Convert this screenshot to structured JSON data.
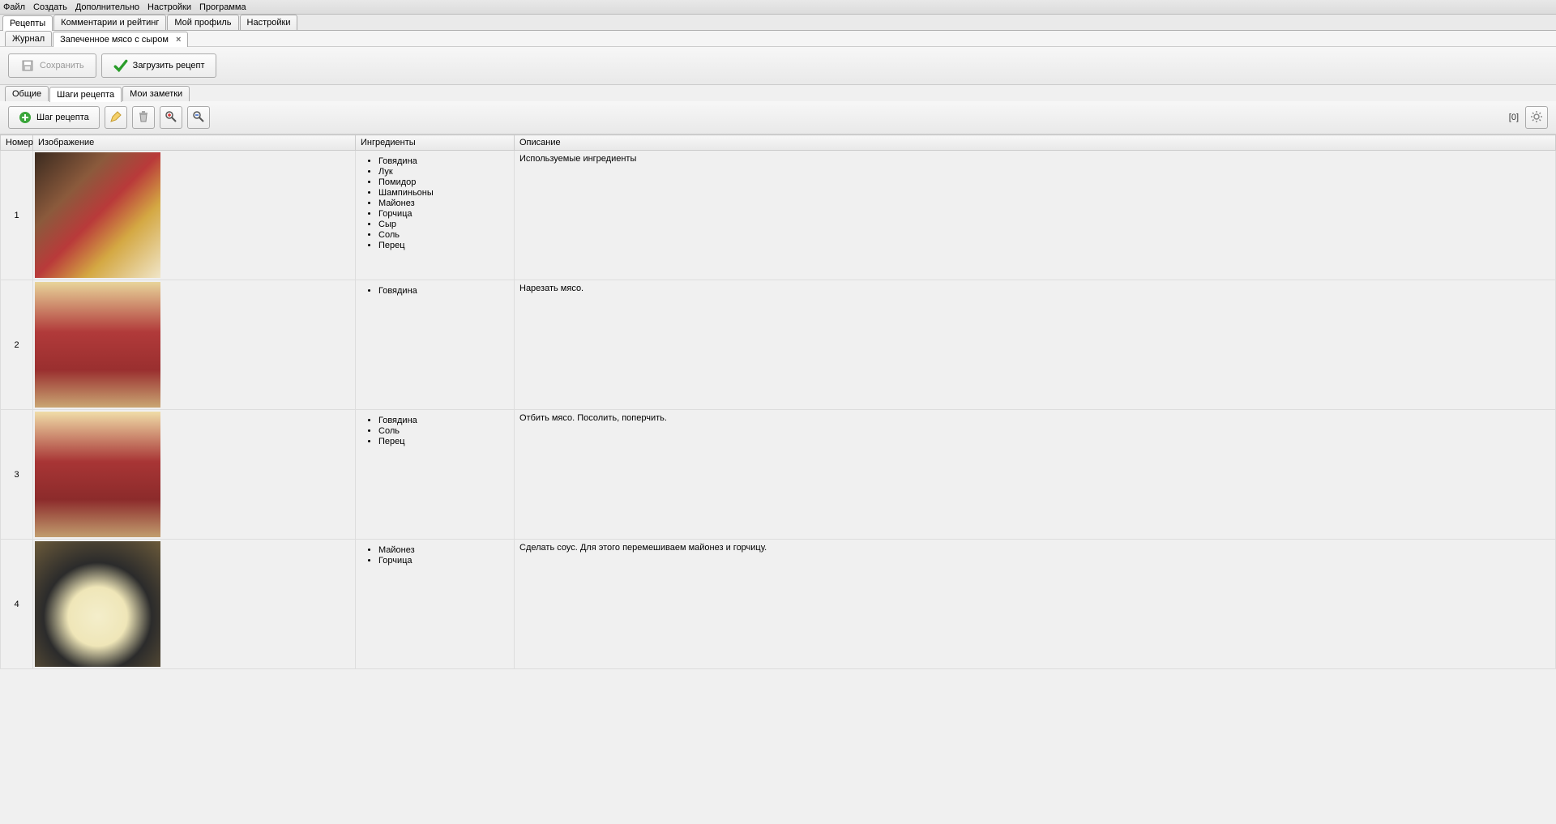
{
  "menu": [
    "Файл",
    "Создать",
    "Дополнительно",
    "Настройки",
    "Программа"
  ],
  "mainTabs": [
    {
      "label": "Рецепты",
      "active": true
    },
    {
      "label": "Комментарии и рейтинг",
      "active": false
    },
    {
      "label": "Мой профиль",
      "active": false
    },
    {
      "label": "Настройки",
      "active": false
    }
  ],
  "subTabs": [
    {
      "label": "Журнал",
      "active": false,
      "closable": false
    },
    {
      "label": "Запеченное мясо с сыром",
      "active": true,
      "closable": true
    }
  ],
  "toolbar": {
    "save": "Сохранить",
    "upload": "Загрузить рецепт"
  },
  "sectionTabs": [
    {
      "label": "Общие",
      "active": false
    },
    {
      "label": "Шаги рецепта",
      "active": true
    },
    {
      "label": "Мои заметки",
      "active": false
    }
  ],
  "stepToolbar": {
    "addStep": "Шаг рецепта",
    "counter": "[0]"
  },
  "table": {
    "headers": {
      "num": "Номер",
      "img": "Изображение",
      "ing": "Ингредиенты",
      "desc": "Описание"
    },
    "rows": [
      {
        "num": "1",
        "ingredients": [
          "Говядина",
          "Лук",
          "Помидор",
          "Шампиньоны",
          "Майонез",
          "Горчица",
          "Сыр",
          "Соль",
          "Перец"
        ],
        "description": "Используемые ингредиенты",
        "imgBg": "linear-gradient(135deg,#3a2a1f,#8b5a3c 30%,#b93a3a 50%,#d4a843 70%,#f0e5c8)"
      },
      {
        "num": "2",
        "ingredients": [
          "Говядина"
        ],
        "description": "Нарезать мясо.",
        "imgBg": "linear-gradient(180deg,#e8d49a,#b13a3a 40%,#9a2f2f 70%,#c9a673)"
      },
      {
        "num": "3",
        "ingredients": [
          "Говядина",
          "Соль",
          "Перец"
        ],
        "description": "Отбить мясо. Посолить, поперчить.",
        "imgBg": "linear-gradient(180deg,#f0dda8,#a83535 40%,#8c2b2b 70%,#c19d6e)"
      },
      {
        "num": "4",
        "ingredients": [
          "Майонез",
          "Горчица"
        ],
        "description": "Сделать соус. Для этого перемешиваем майонез и горчицу.",
        "imgBg": "radial-gradient(circle at 50% 60%,#f4eecb 0%,#efe6b8 30%,#2b2b2b 55%,#6b5a3a 100%)"
      }
    ]
  }
}
